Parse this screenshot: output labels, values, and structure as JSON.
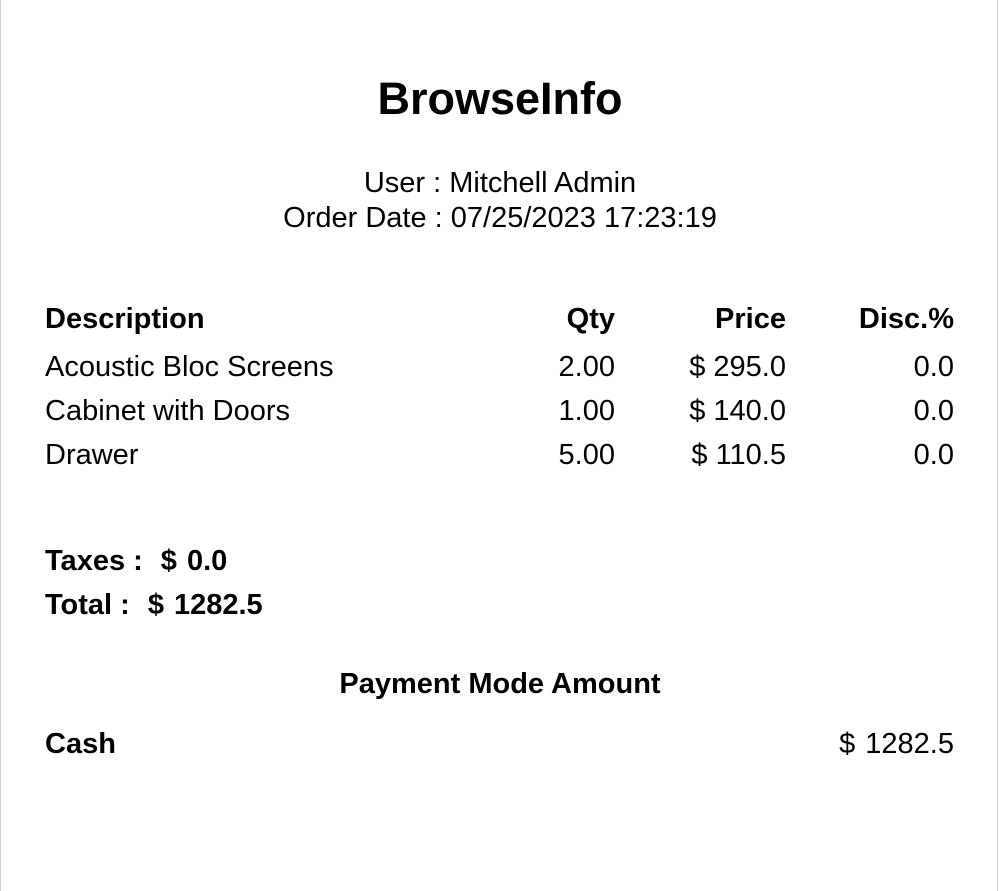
{
  "receipt": {
    "company": "BrowseInfo",
    "user_label": "User :",
    "user_name": "Mitchell Admin",
    "order_date_label": "Order Date :",
    "order_date": "07/25/2023 17:23:19",
    "columns": {
      "description": "Description",
      "qty": "Qty",
      "price": "Price",
      "disc": "Disc.%"
    },
    "lines": [
      {
        "description": "Acoustic Bloc Screens",
        "qty": "2.00",
        "price": "$ 295.0",
        "disc": "0.0"
      },
      {
        "description": "Cabinet with Doors",
        "qty": "1.00",
        "price": "$ 140.0",
        "disc": "0.0"
      },
      {
        "description": "Drawer",
        "qty": "5.00",
        "price": "$ 110.5",
        "disc": "0.0"
      }
    ],
    "taxes_label": "Taxes :",
    "taxes_currency": "$",
    "taxes_value": "0.0",
    "total_label": "Total :",
    "total_currency": "$",
    "total_value": "1282.5",
    "payment_header": "Payment Mode Amount",
    "payment": {
      "mode": "Cash",
      "currency": "$",
      "amount": "1282.5"
    }
  }
}
